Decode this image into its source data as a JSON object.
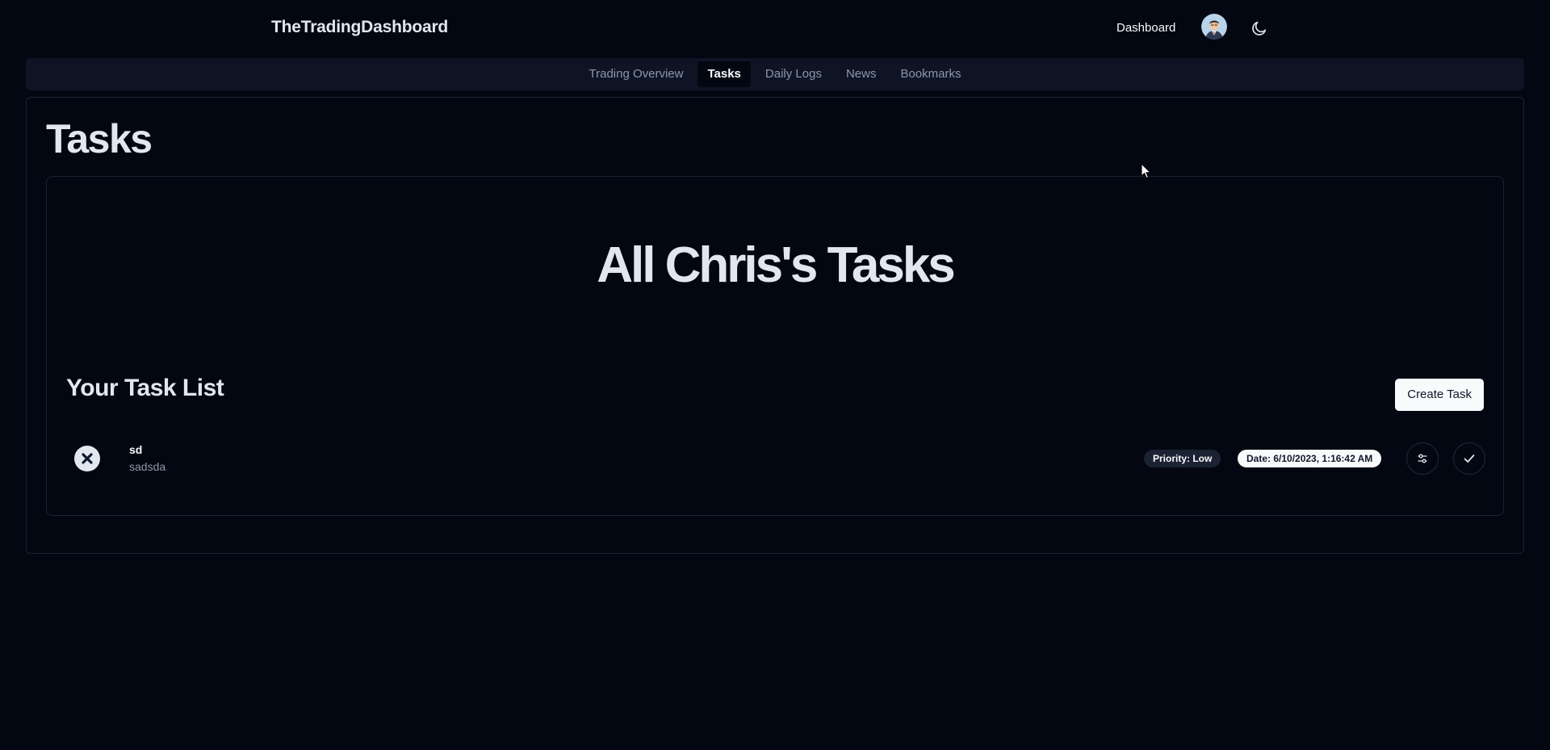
{
  "header": {
    "brand": "TheTradingDashboard",
    "dashboard_link": "Dashboard"
  },
  "nav": {
    "tabs": [
      {
        "label": "Trading Overview",
        "active": false
      },
      {
        "label": "Tasks",
        "active": true
      },
      {
        "label": "Daily Logs",
        "active": false
      },
      {
        "label": "News",
        "active": false
      },
      {
        "label": "Bookmarks",
        "active": false
      }
    ]
  },
  "main": {
    "page_title": "Tasks",
    "card": {
      "hero_title": "All Chris's Tasks",
      "list_title": "Your Task List",
      "create_button": "Create Task",
      "tasks": [
        {
          "title": "sd",
          "description": "sadsda",
          "priority": "Priority: Low",
          "date": "Date: 6/10/2023, 1:16:42 AM",
          "status_icon": "close-icon"
        }
      ]
    }
  },
  "colors": {
    "background": "#030711",
    "nav_background": "#0e1424",
    "border": "#1a2233",
    "text_primary": "#e1e7ef",
    "text_muted": "#8b97ab",
    "button_light": "#f8fafc"
  },
  "icons": {
    "theme_toggle": "moon-icon",
    "edit": "sliders-icon",
    "complete": "check-icon"
  }
}
